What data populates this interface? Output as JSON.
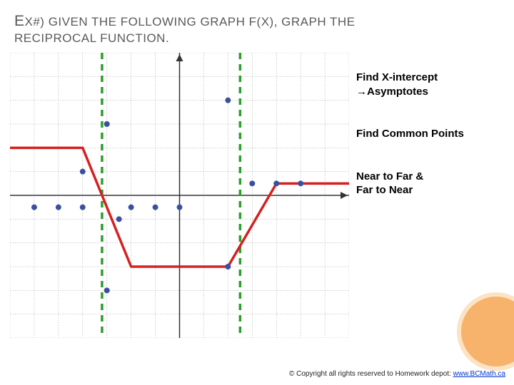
{
  "title_part1": "E",
  "title_part2": "X#) G",
  "title_part3": "IVEN THE FOLLOWING GRAPH F(X), GRAPH THE",
  "subtitle": "RECIPROCAL FUNCTION.",
  "side": {
    "step1a": "Find X-intercept",
    "step1b": "→Asymptotes",
    "step2": "Find Common Points",
    "step3a": "Near to Far &",
    "step3b": "Far to Near"
  },
  "footer": {
    "text": "© Copyright all rights reserved to Homework depot: ",
    "link": "www.BCMath.ca"
  },
  "chart_data": {
    "type": "line",
    "title": "",
    "xlabel": "",
    "ylabel": "",
    "xlim": [
      -7,
      7
    ],
    "ylim": [
      -6,
      6
    ],
    "grid": true,
    "series": [
      {
        "name": "f(x)",
        "color": "#d52020",
        "x": [
          -7,
          -4,
          -2,
          2,
          4,
          7
        ],
        "y": [
          2,
          2,
          -3,
          -3,
          0.5,
          0.5
        ]
      }
    ],
    "asymptotes": [
      {
        "x": -3.2,
        "color": "#2aa02a"
      },
      {
        "x": 2.5,
        "color": "#2aa02a"
      }
    ],
    "points": {
      "color": "#3a4fa0",
      "xy": [
        [
          -6,
          -0.5
        ],
        [
          -5,
          -0.5
        ],
        [
          -4,
          -0.5
        ],
        [
          -4,
          1
        ],
        [
          -3,
          3
        ],
        [
          -3,
          -4
        ],
        [
          -2.5,
          -1
        ],
        [
          -2,
          -0.5
        ],
        [
          -1,
          -0.5
        ],
        [
          0,
          -0.5
        ],
        [
          2,
          -3
        ],
        [
          2,
          4
        ],
        [
          3,
          0.5
        ],
        [
          4,
          0.5
        ],
        [
          5,
          0.5
        ]
      ]
    }
  }
}
